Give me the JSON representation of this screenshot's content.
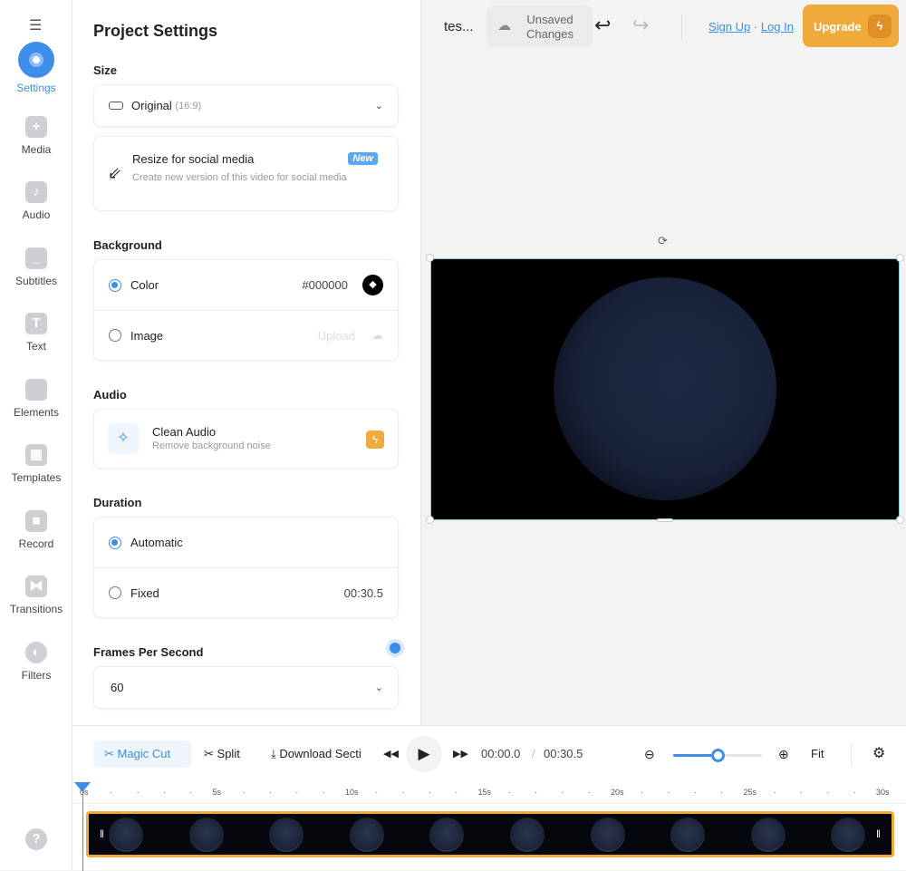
{
  "sidebar": {
    "items": [
      {
        "label": "Settings",
        "icon": "settings-icon",
        "active": true
      },
      {
        "label": "Media",
        "icon": "plus-icon"
      },
      {
        "label": "Audio",
        "icon": "music-icon"
      },
      {
        "label": "Subtitles",
        "icon": "subtitles-icon"
      },
      {
        "label": "Text",
        "icon": "text-icon"
      },
      {
        "label": "Elements",
        "icon": "elements-icon"
      },
      {
        "label": "Templates",
        "icon": "templates-icon"
      },
      {
        "label": "Record",
        "icon": "record-icon"
      },
      {
        "label": "Transitions",
        "icon": "transitions-icon"
      },
      {
        "label": "Filters",
        "icon": "filters-icon"
      }
    ],
    "help": "?"
  },
  "panel": {
    "title": "Project Settings",
    "size": {
      "label": "Size",
      "value": "Original",
      "ratio": "(16:9)"
    },
    "resize": {
      "title": "Resize for social media",
      "desc": "Create new version of this video for social media",
      "badge": "New"
    },
    "background": {
      "label": "Background",
      "color_label": "Color",
      "color_value": "#000000",
      "image_label": "Image",
      "upload": "Upload",
      "selected": "Color"
    },
    "audio": {
      "label": "Audio",
      "title": "Clean Audio",
      "desc": "Remove background noise"
    },
    "duration": {
      "label": "Duration",
      "automatic": "Automatic",
      "fixed": "Fixed",
      "fixed_value": "00:30.5",
      "selected": "Automatic"
    },
    "fps": {
      "label": "Frames Per Second",
      "value": "60"
    }
  },
  "topbar": {
    "project": "tes...",
    "save_status": "Unsaved Changes",
    "sign_up": "Sign Up",
    "sep": "·",
    "log_in": "Log In",
    "upgrade": "Upgrade"
  },
  "timeline": {
    "magic_cut": "Magic Cut",
    "split": "Split",
    "download": "Download Secti",
    "current": "00:00.0",
    "slash": "/",
    "total": "00:30.5",
    "fit": "Fit",
    "zoom_level": 0.5,
    "ticks": [
      "0s",
      "5s",
      "10s",
      "15s",
      "20s",
      "25s",
      "30s"
    ]
  },
  "colors": {
    "accent": "#3d8ee8",
    "upgrade": "#f0a93b"
  }
}
